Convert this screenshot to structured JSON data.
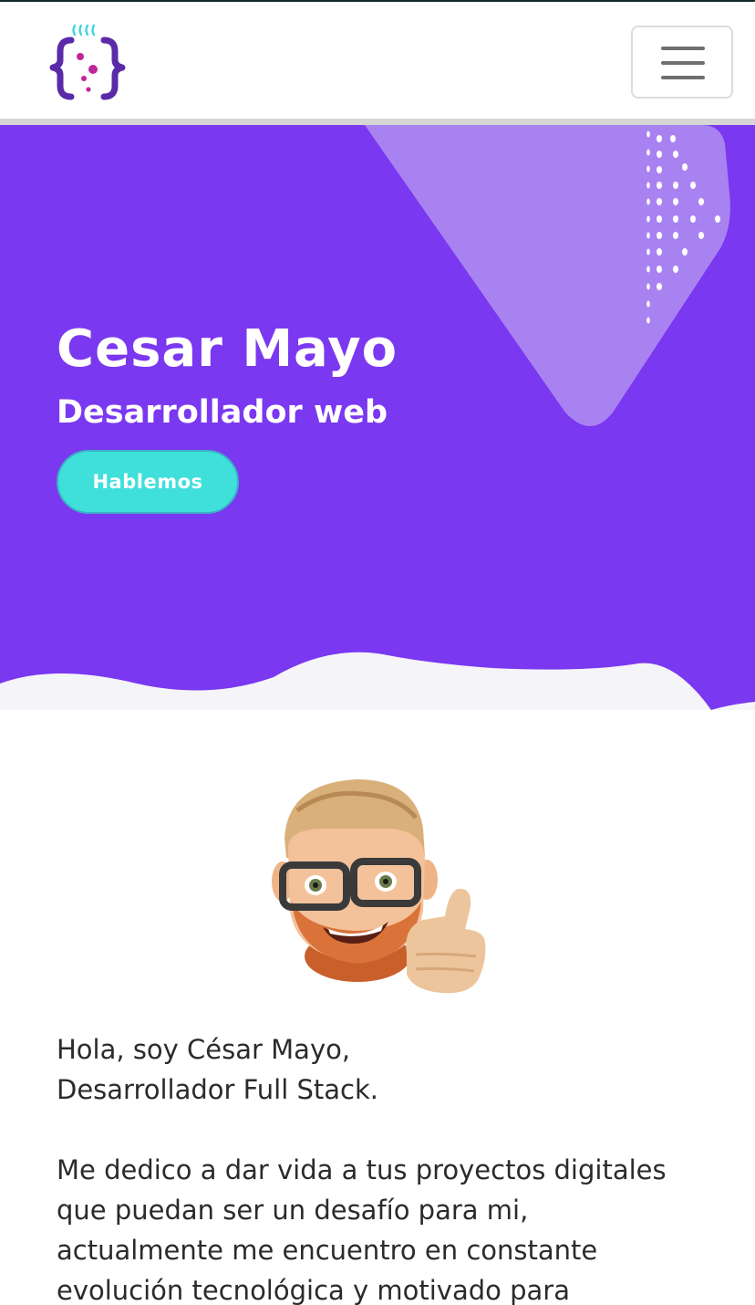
{
  "hero": {
    "name": "Cesar Mayo",
    "role": "Desarrollador web",
    "cta_label": "Hablemos"
  },
  "about": {
    "greeting_line1": "Hola, soy César Mayo,",
    "greeting_line2": "Desarrollador Full Stack.",
    "body_lines": [
      "Me dedico a dar vida a tus proyectos digitales",
      "que puedan ser un desafío para mi,",
      "actualmente me encuentro en constante",
      "evolución tecnológica y motivado para"
    ]
  },
  "icons": {
    "logo": "curly-braces-logo-icon",
    "menu": "hamburger-menu-icon",
    "avatar": "memoji-thumbs-up-avatar"
  },
  "colors": {
    "hero_purple": "#7a38f0",
    "hero_light_purple": "#a982f2",
    "accent_cyan": "#3fe0da",
    "logo_purple": "#5a2aa8",
    "logo_magenta": "#c0269a"
  }
}
